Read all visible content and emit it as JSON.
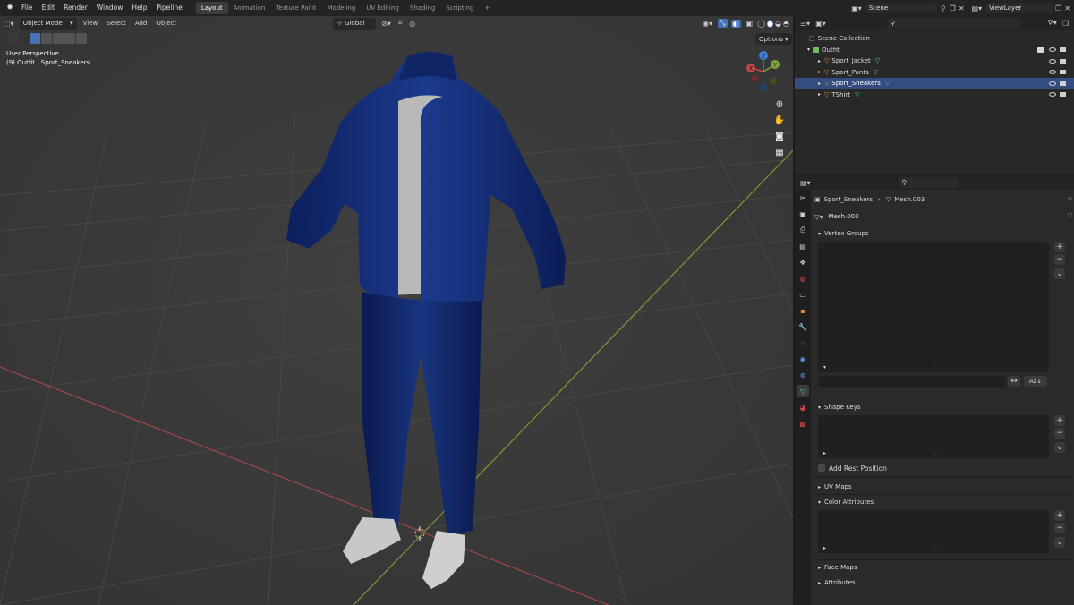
{
  "app": {
    "menus": [
      "File",
      "Edit",
      "Render",
      "Window",
      "Help",
      "Pipeline"
    ],
    "workspace_tabs": [
      "Layout",
      "Animation",
      "Texture Paint",
      "Modeling",
      "UV Editing",
      "Shading",
      "Scripting",
      "+"
    ],
    "active_workspace": "Layout",
    "scene_name": "Scene",
    "view_layer": "ViewLayer"
  },
  "viewport": {
    "mode": "Object Mode",
    "menus": [
      "View",
      "Select",
      "Add",
      "Object"
    ],
    "transform_orientation": "Global",
    "options_label": "Options",
    "overlay_line1": "User Perspective",
    "overlay_line2": "(9) Outfit | Sport_Sneakers",
    "gizmo_axes": [
      "Z",
      "Y",
      "X"
    ],
    "nav_icons": [
      "zoom-icon",
      "hand-icon",
      "camera-icon",
      "grid-icon"
    ]
  },
  "outliner": {
    "root": "Scene Collection",
    "collection": "Outfit",
    "objects": [
      "Sport_Jacket",
      "Sport_Pants",
      "Sport_Sneakers",
      "TShirt"
    ],
    "selected": "Sport_Sneakers"
  },
  "properties": {
    "breadcrumb_object": "Sport_Sneakers",
    "breadcrumb_mesh": "Mesh.003",
    "mesh_name": "Mesh.003",
    "panels": {
      "vertex_groups": "Vertex Groups",
      "shape_keys": "Shape Keys",
      "add_rest_position": "Add Rest Position",
      "uv_maps": "UV Maps",
      "color_attributes": "Color Attributes",
      "face_maps": "Face Maps",
      "attributes": "Attributes"
    }
  },
  "colors": {
    "accent": "#4772b3",
    "x_axis": "#c44848",
    "y_axis": "#7fa33a",
    "z_axis": "#3d7fd9",
    "mesh_icon": "#e88a3a",
    "data_icon": "#59c99b"
  }
}
